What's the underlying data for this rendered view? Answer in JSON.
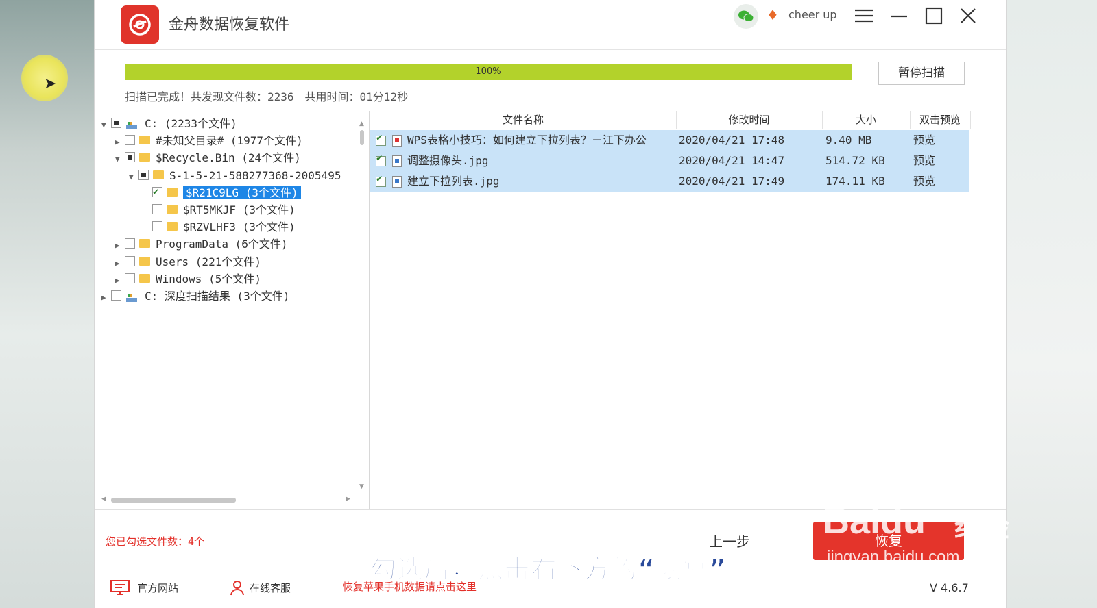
{
  "app": {
    "title": "金舟数据恢复软件",
    "user": "cheer up",
    "version": "V 4.6.7"
  },
  "scan": {
    "progress_pct": 100,
    "progress_label": "100%",
    "pause_label": "暂停扫描",
    "status": "扫描已完成！共发现文件数：2236　共用时间：01分12秒"
  },
  "tree": {
    "items": [
      {
        "label": "C:",
        "count": "(2233个文件)",
        "level": 0,
        "expanded": true,
        "check": "partial",
        "icon": "drive-icon"
      },
      {
        "label": "#未知父目录#",
        "count": "(1977个文件)",
        "level": 1,
        "expanded": false,
        "check": "none",
        "icon": "folder-icon"
      },
      {
        "label": "$Recycle.Bin",
        "count": "(24个文件)",
        "level": 1,
        "expanded": true,
        "check": "partial",
        "icon": "folder-icon"
      },
      {
        "label": "S-1-5-21-588277368-2005495",
        "count": "",
        "level": 2,
        "expanded": true,
        "check": "partial",
        "icon": "folder-icon"
      },
      {
        "label": "$R21C9LG",
        "count": "(3个文件)",
        "level": 3,
        "selected": true,
        "check": "checked",
        "icon": "folder-icon"
      },
      {
        "label": "$RT5MKJF",
        "count": "(3个文件)",
        "level": 3,
        "check": "none",
        "icon": "folder-icon"
      },
      {
        "label": "$RZVLHF3",
        "count": "(3个文件)",
        "level": 3,
        "check": "none",
        "icon": "folder-icon"
      },
      {
        "label": "ProgramData",
        "count": "(6个文件)",
        "level": 1,
        "expanded": false,
        "check": "none",
        "icon": "folder-icon"
      },
      {
        "label": "Users",
        "count": "(221个文件)",
        "level": 1,
        "expanded": false,
        "check": "none",
        "icon": "folder-icon"
      },
      {
        "label": "Windows",
        "count": "(5个文件)",
        "level": 1,
        "expanded": false,
        "check": "none",
        "icon": "folder-icon"
      },
      {
        "label": "C: 深度扫描结果",
        "count": "(3个文件)",
        "level": 0,
        "expanded": false,
        "check": "none",
        "icon": "drive-icon"
      }
    ]
  },
  "file_list": {
    "columns": [
      "文件名称",
      "修改时间",
      "大小",
      "双击预览"
    ],
    "rows": [
      {
        "name": "WPS表格小技巧：如何建立下拉列表？－江下办公",
        "modified": "2020/04/21 17:48",
        "size": "9.40 MB",
        "preview": "预览",
        "icon": "wps-file-icon"
      },
      {
        "name": "调整摄像头.jpg",
        "modified": "2020/04/21 14:47",
        "size": "514.72 KB",
        "preview": "预览",
        "icon": "image-file-icon"
      },
      {
        "name": "建立下拉列表.jpg",
        "modified": "2020/04/21 17:49",
        "size": "174.11 KB",
        "preview": "预览",
        "icon": "image-file-icon"
      }
    ]
  },
  "bottom": {
    "selected_count": "您已勾选文件数：4个",
    "back_label": "上一步",
    "recover_label": "恢复"
  },
  "footer": {
    "website": "官方网站",
    "support": "在线客服",
    "promo": "恢复苹果手机数据请点击这里"
  },
  "overlay": {
    "subtitle": "勾选后，点击右下方的“恢复”",
    "watermark_logo": "Baidu",
    "watermark_cn": "经验",
    "watermark_url": "jingyan.baidu.com"
  },
  "colors": {
    "accent": "#e4342b",
    "progress": "#b3d22b",
    "selection": "#1e86e6",
    "row_highlight": "#c9e3f8"
  }
}
